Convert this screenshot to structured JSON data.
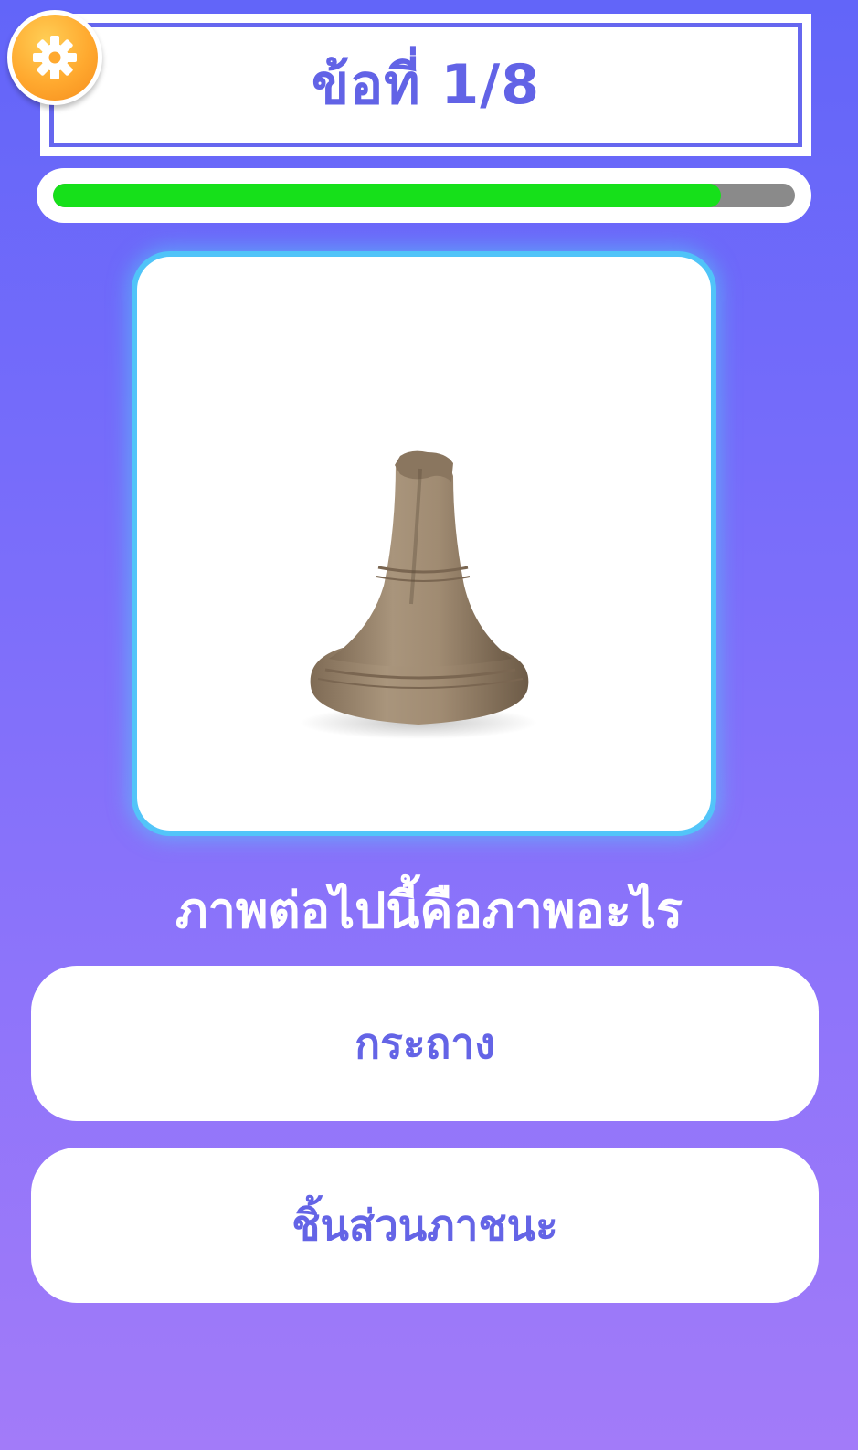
{
  "header": {
    "title": "ข้อที่ 1/8"
  },
  "settings": {
    "icon": "gear-icon"
  },
  "progress": {
    "fraction": 0.9
  },
  "question": {
    "text": "ภาพต่อไปนี้คือภาพอะไร"
  },
  "answers": [
    {
      "label": "กระถาง"
    },
    {
      "label": "ชิ้นส่วนภาชนะ"
    }
  ],
  "colors": {
    "background_top": "#6265f9",
    "background_bottom": "#a27bf9",
    "accent": "#6263e6",
    "progress_fill": "#16e01a",
    "progress_track": "#8a8a8a",
    "card_glow": "#4eccf8",
    "settings_button": "#ffa92f"
  }
}
